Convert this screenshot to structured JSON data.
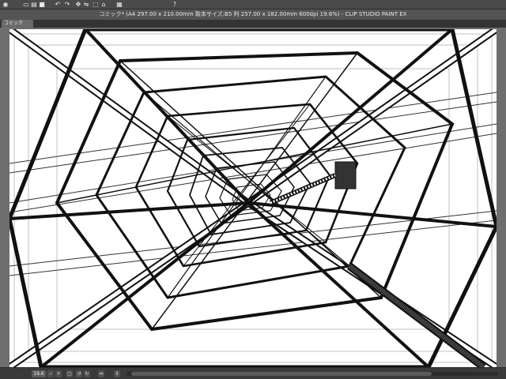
{
  "window": {
    "title": "コミック* (A4 297.00 x 210.00mm 製本サイズ:B5 判 257.00 x 182.00mm 600dpi 19.6%)  - CLIP STUDIO PAINT EX"
  },
  "toolbar": {
    "icons": [
      "menu-icon",
      "new-file-icon",
      "open-file-icon",
      "save-icon",
      "undo-icon",
      "redo-icon",
      "pan-icon",
      "flip-icon",
      "transform-icon",
      "lasso-icon",
      "fill-icon",
      "help-icon"
    ]
  },
  "document_tab": {
    "label": "コミック"
  },
  "status_bar": {
    "zoom": "19.6"
  }
}
